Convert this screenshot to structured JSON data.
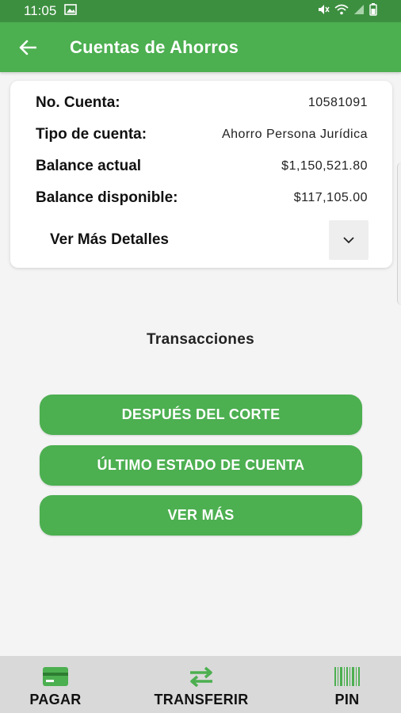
{
  "status_bar": {
    "time": "11:05"
  },
  "app_bar": {
    "title": "Cuentas de Ahorros"
  },
  "account": {
    "rows": [
      {
        "label": "No. Cuenta:",
        "value": "10581091"
      },
      {
        "label": "Tipo de cuenta:",
        "value": "Ahorro Persona Jurídica"
      },
      {
        "label": "Balance actual",
        "value": "$1,150,521.80"
      },
      {
        "label": "Balance disponible:",
        "value": "$117,105.00"
      }
    ],
    "details_label": "Ver Más Detalles"
  },
  "transactions": {
    "title": "Transacciones",
    "buttons": [
      {
        "label": "DESPUÉS DEL CORTE"
      },
      {
        "label": "ÚLTIMO ESTADO DE CUENTA"
      },
      {
        "label": "VER MÁS"
      }
    ]
  },
  "bottom_nav": {
    "items": [
      {
        "label": "PAGAR",
        "icon": "card-icon"
      },
      {
        "label": "TRANSFERIR",
        "icon": "transfer-arrows-icon"
      },
      {
        "label": "PIN",
        "icon": "barcode-icon"
      }
    ]
  },
  "colors": {
    "primary": "#4caf50",
    "status_bar": "#3d8f40",
    "nav_bg": "#d9d9d9"
  }
}
